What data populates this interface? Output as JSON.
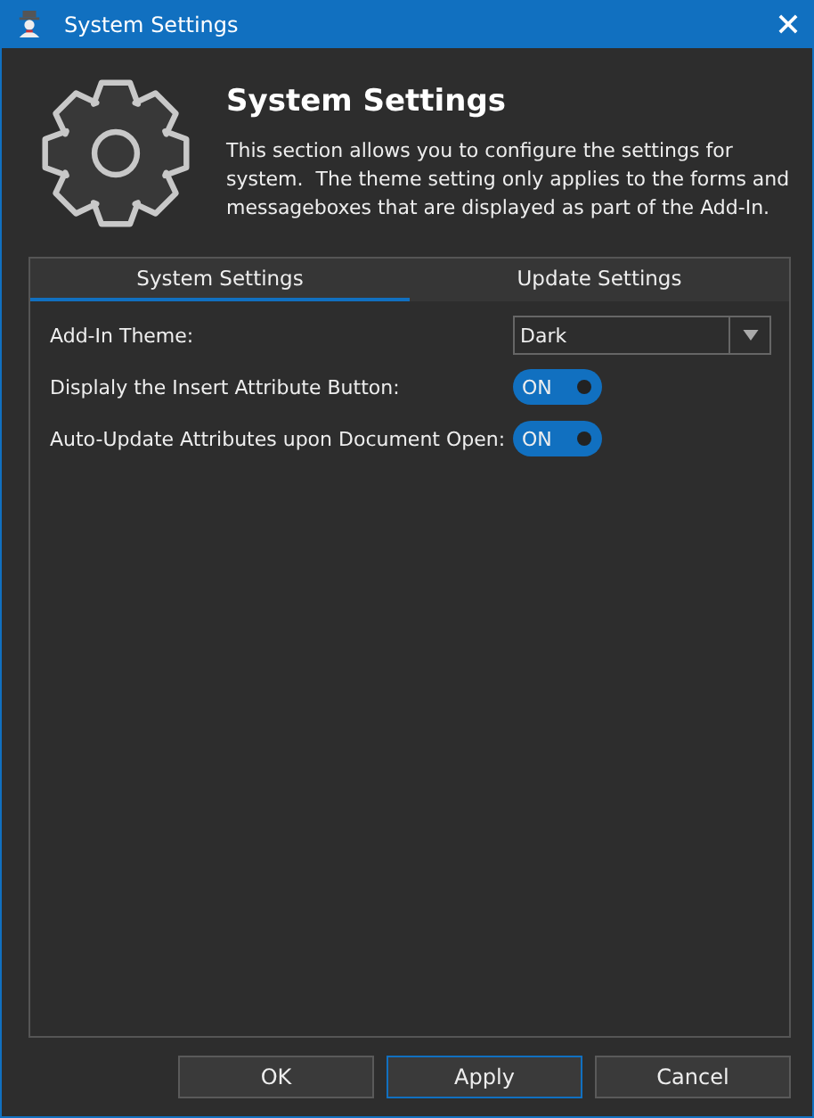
{
  "window": {
    "title": "System Settings"
  },
  "header": {
    "title": "System Settings",
    "description": "This section allows you to configure the settings for system.  The theme setting only applies to the forms and messageboxes that are displayed as part of the Add-In."
  },
  "tabs": [
    {
      "label": "System Settings",
      "selected": true
    },
    {
      "label": "Update Settings",
      "selected": false
    }
  ],
  "settings": [
    {
      "kind": "dropdown",
      "label": "Add-In Theme:",
      "value": "Dark"
    },
    {
      "kind": "toggle",
      "label": "Displaly the Insert Attribute Button:",
      "value": "ON",
      "on": true
    },
    {
      "kind": "toggle",
      "label": "Auto-Update Attributes upon Document Open:",
      "value": "ON",
      "on": true
    }
  ],
  "buttons": [
    {
      "label": "OK",
      "default": false
    },
    {
      "label": "Apply",
      "default": true
    },
    {
      "label": "Cancel",
      "default": false
    }
  ]
}
